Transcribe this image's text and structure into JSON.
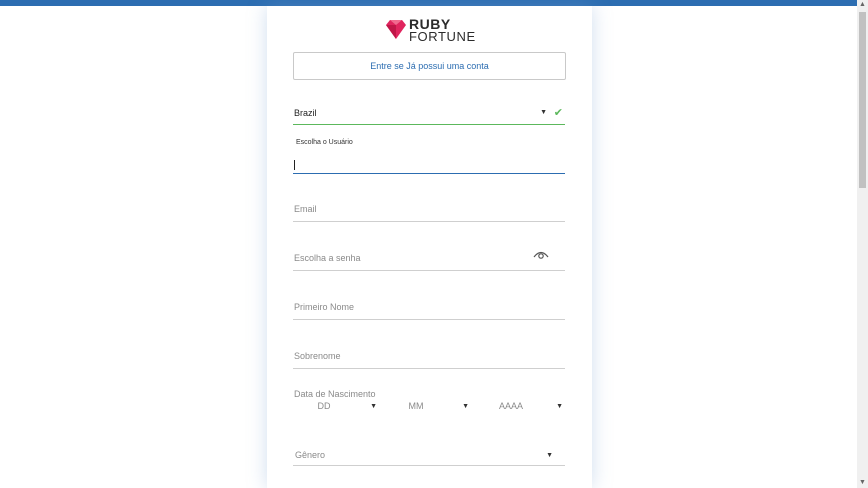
{
  "brand": {
    "line1": "RUBY",
    "line2": "FORTUNE",
    "gem_color": "#e0245e"
  },
  "login_button": {
    "label": "Entre se Já possui uma conta"
  },
  "country": {
    "value": "Brazil"
  },
  "username": {
    "label": "Escolha o Usuário",
    "value": ""
  },
  "email": {
    "placeholder": "Email"
  },
  "password": {
    "placeholder": "Escolha a senha"
  },
  "first_name": {
    "placeholder": "Primeiro Nome"
  },
  "last_name": {
    "placeholder": "Sobrenome"
  },
  "birthdate": {
    "label": "Data de Nascimento",
    "day": "DD",
    "month": "MM",
    "year": "AAAA"
  },
  "gender": {
    "placeholder": "Gênero"
  },
  "colors": {
    "accent": "#2c6db1",
    "valid": "#5cb85c"
  },
  "icons": [
    "ruby-gem-icon",
    "caret-down-icon",
    "check-icon",
    "eye-icon"
  ]
}
